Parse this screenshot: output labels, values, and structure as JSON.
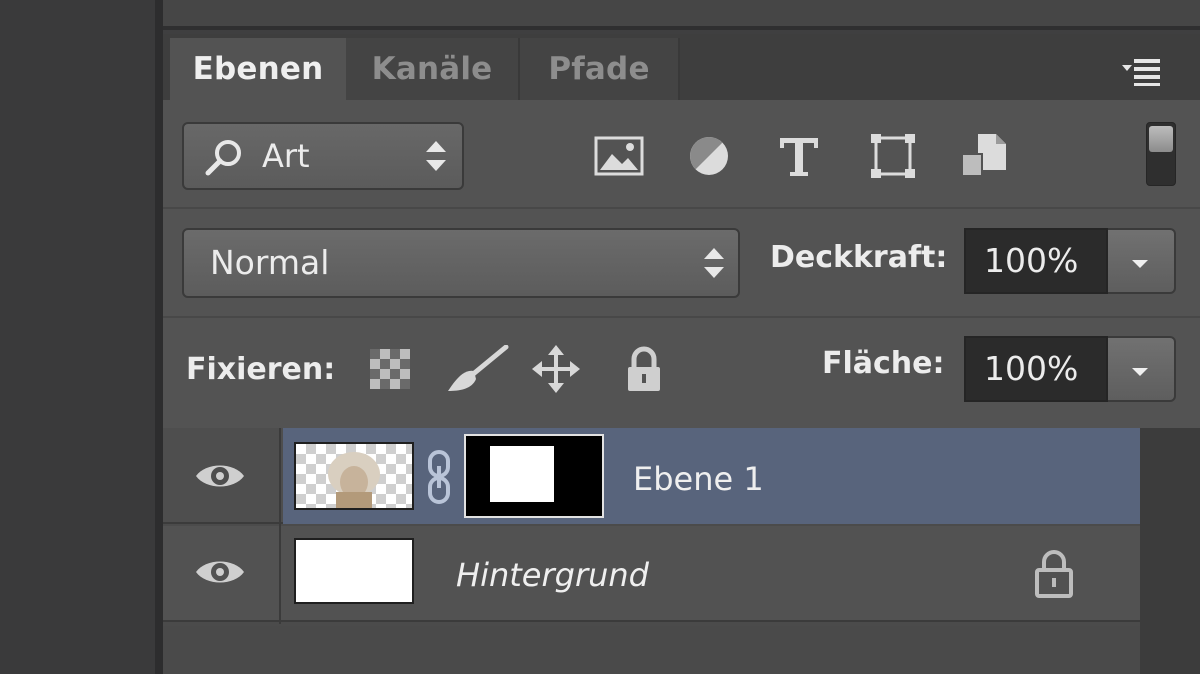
{
  "tabs": [
    {
      "label": "Ebenen",
      "active": true
    },
    {
      "label": "Kanäle",
      "active": false
    },
    {
      "label": "Pfade",
      "active": false
    }
  ],
  "filter": {
    "value": "Art",
    "buttons": [
      "image-filter-icon",
      "adjustment-filter-icon",
      "type-filter-icon",
      "shape-filter-icon",
      "smart-object-filter-icon"
    ]
  },
  "blend": {
    "mode": "Normal"
  },
  "opacity": {
    "label": "Deckkraft:",
    "value": "100%"
  },
  "lock": {
    "label": "Fixieren:"
  },
  "fill": {
    "label": "Fläche:",
    "value": "100%"
  },
  "layers": [
    {
      "name": "Ebene 1",
      "selected": true,
      "visible": true,
      "has_mask": true
    },
    {
      "name": "Hintergrund",
      "selected": false,
      "visible": true,
      "locked": true
    }
  ],
  "colors": {
    "panel": "#535353",
    "selected_row": "#58647c",
    "field": "#2b2b2b"
  }
}
